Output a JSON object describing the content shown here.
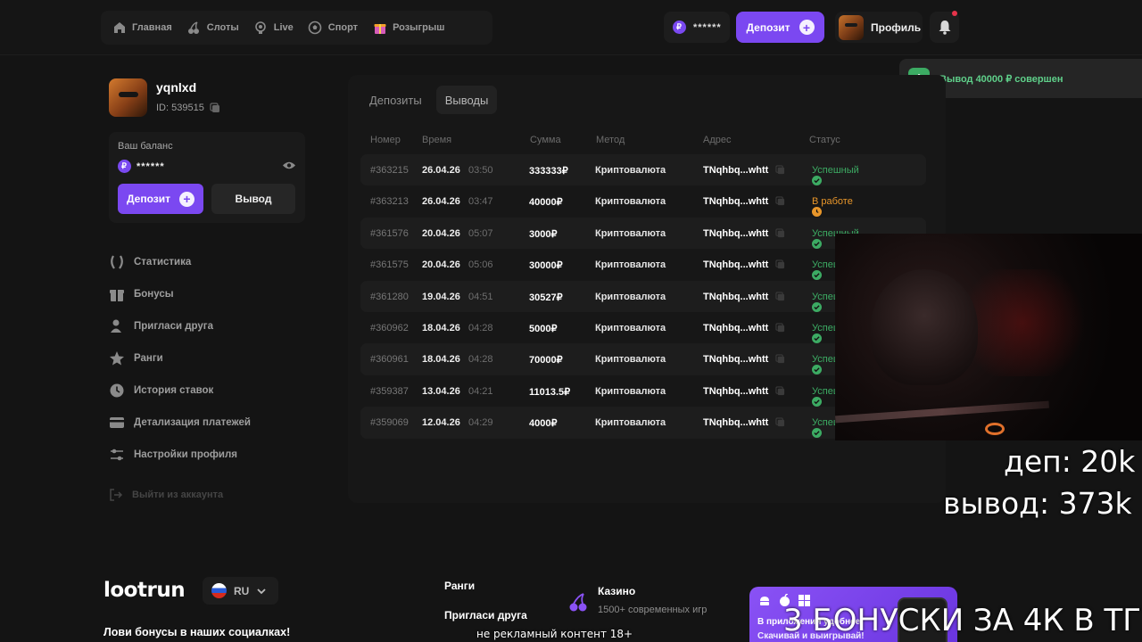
{
  "nav": {
    "items": [
      {
        "label": "Главная",
        "icon": "home-icon"
      },
      {
        "label": "Слоты",
        "icon": "cherry-icon"
      },
      {
        "label": "Live",
        "icon": "live-icon"
      },
      {
        "label": "Спорт",
        "icon": "ball-icon"
      },
      {
        "label": "Розыгрыш",
        "icon": "gift-icon"
      }
    ]
  },
  "header": {
    "balance_masked": "******",
    "coin_symbol": "₽",
    "deposit_label": "Депозит",
    "profile_label": "Профиль",
    "accent_color": "#7b48f1"
  },
  "toast": {
    "text": "Вывод 40000 ₽ совершен",
    "color": "#5fd08a"
  },
  "user": {
    "name": "yqnlxd",
    "id": "ID: 539515"
  },
  "balance": {
    "label": "Ваш баланс",
    "value": "******",
    "deposit_label": "Депозит",
    "withdraw_label": "Вывод"
  },
  "menu": [
    {
      "label": "Статистика",
      "icon": "laurel-icon"
    },
    {
      "label": "Бонусы",
      "icon": "gift-icon"
    },
    {
      "label": "Пригласи друга",
      "icon": "user-add-icon"
    },
    {
      "label": "Ранги",
      "icon": "star-icon"
    },
    {
      "label": "История ставок",
      "icon": "clock-icon"
    },
    {
      "label": "Детализация платежей",
      "icon": "card-icon"
    },
    {
      "label": "Настройки профиля",
      "icon": "sliders-icon"
    }
  ],
  "logout_label": "Выйти из аккаунта",
  "tabs": [
    {
      "label": "Депозиты",
      "active": false
    },
    {
      "label": "Выводы",
      "active": true
    }
  ],
  "table": {
    "headers": [
      "Номер",
      "Время",
      "Сумма",
      "Метод",
      "Адрес",
      "Статус"
    ],
    "rows": [
      {
        "num": "#363215",
        "date": "26.04.26",
        "time": "03:50",
        "sum": "333333₽",
        "method": "Криптовалюта",
        "addr": "TNqhbq...whtt",
        "status": "Успешный",
        "state": "success"
      },
      {
        "num": "#363213",
        "date": "26.04.26",
        "time": "03:47",
        "sum": "40000₽",
        "method": "Криптовалюта",
        "addr": "TNqhbq...whtt",
        "status": "В работе",
        "state": "pending"
      },
      {
        "num": "#361576",
        "date": "20.04.26",
        "time": "05:07",
        "sum": "3000₽",
        "method": "Криптовалюта",
        "addr": "TNqhbq...whtt",
        "status": "Успешный",
        "state": "success"
      },
      {
        "num": "#361575",
        "date": "20.04.26",
        "time": "05:06",
        "sum": "30000₽",
        "method": "Криптовалюта",
        "addr": "TNqhbq...whtt",
        "status": "Успешный",
        "state": "success"
      },
      {
        "num": "#361280",
        "date": "19.04.26",
        "time": "04:51",
        "sum": "30527₽",
        "method": "Криптовалюта",
        "addr": "TNqhbq...whtt",
        "status": "Успешный",
        "state": "success"
      },
      {
        "num": "#360962",
        "date": "18.04.26",
        "time": "04:28",
        "sum": "5000₽",
        "method": "Криптовалюта",
        "addr": "TNqhbq...whtt",
        "status": "Успешный",
        "state": "success"
      },
      {
        "num": "#360961",
        "date": "18.04.26",
        "time": "04:28",
        "sum": "70000₽",
        "method": "Криптовалюта",
        "addr": "TNqhbq...whtt",
        "status": "Успешный",
        "state": "success"
      },
      {
        "num": "#359387",
        "date": "13.04.26",
        "time": "04:21",
        "sum": "11013.5₽",
        "method": "Криптовалюта",
        "addr": "TNqhbq...whtt",
        "status": "Успешный",
        "state": "success"
      },
      {
        "num": "#359069",
        "date": "12.04.26",
        "time": "04:29",
        "sum": "4000₽",
        "method": "Криптовалюта",
        "addr": "TNqhbq...whtt",
        "status": "Успешный",
        "state": "success"
      }
    ],
    "status_colors": {
      "success": "#3cab63",
      "pending": "#e8962a"
    }
  },
  "overlay": {
    "dep": "деп: 20k",
    "wd": "вывод: 373k",
    "bonus": "3 БОНУСКИ ЗА 4К В ТГ",
    "sub": "не рекламный контент 18+"
  },
  "footer": {
    "logo": "lootrun",
    "lang": "RU",
    "socials": "Лови бонусы в наших социалках!",
    "links": [
      "Ранги",
      "Пригласи друга"
    ],
    "casino_title": "Казино",
    "casino_sub": "1500+ современных игр",
    "app_t1": "В приложении удобнее",
    "app_t2": "Скачивай и выигрывай!"
  }
}
